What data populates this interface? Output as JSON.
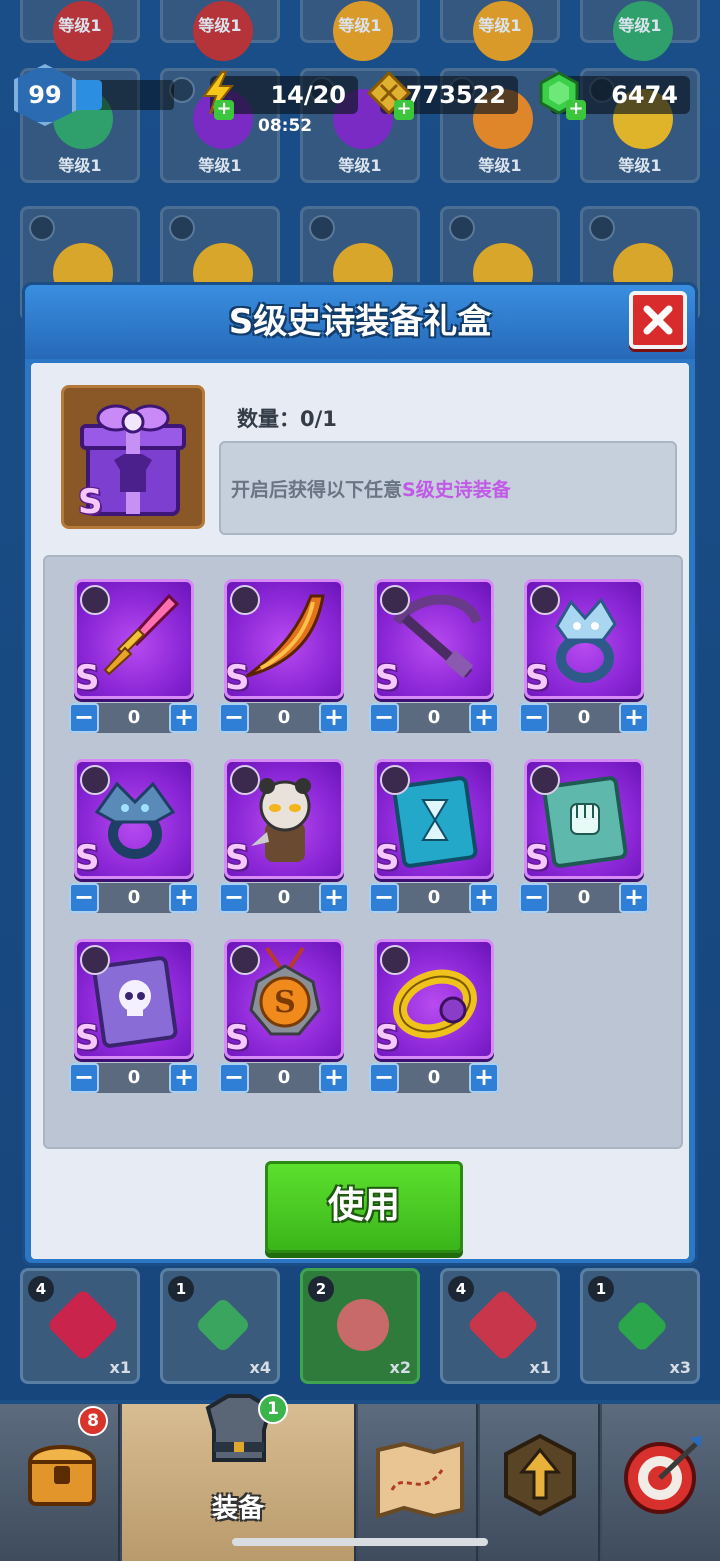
{
  "hud": {
    "level": "99",
    "energy": "14/20",
    "timer": "08:52",
    "gold": "773522",
    "gems": "6474"
  },
  "background": {
    "level_label": "等级1",
    "gem_counts": [
      "4",
      "1",
      "2",
      "4",
      "1"
    ],
    "gem_multipliers": [
      "x1",
      "x4",
      "x2",
      "x1",
      "x3"
    ]
  },
  "dialog": {
    "title": "S级史诗装备礼盒",
    "quantity_label": "数量：0/1",
    "description_prefix": "开启后获得以下任意",
    "description_highlight": "S级史诗装备",
    "box_grade": "S",
    "use_label": "使用",
    "items": [
      {
        "name": "sword",
        "type": "weapon",
        "grade": "S",
        "count": "0"
      },
      {
        "name": "curved-blade",
        "type": "weapon",
        "grade": "S",
        "count": "0"
      },
      {
        "name": "crossbow",
        "type": "weapon",
        "grade": "S",
        "count": "0"
      },
      {
        "name": "dragon-ring-ice",
        "type": "ring",
        "grade": "S",
        "count": "0"
      },
      {
        "name": "dragon-ring-dark",
        "type": "ring",
        "grade": "S",
        "count": "0"
      },
      {
        "name": "panda-pet",
        "type": "pet",
        "grade": "S",
        "count": "0"
      },
      {
        "name": "hourglass-book",
        "type": "book",
        "grade": "S",
        "count": "0"
      },
      {
        "name": "fist-book",
        "type": "book",
        "grade": "S",
        "count": "0"
      },
      {
        "name": "skull-book",
        "type": "book",
        "grade": "S",
        "count": "0"
      },
      {
        "name": "s-medallion",
        "type": "amulet",
        "grade": "S",
        "count": "0"
      },
      {
        "name": "gold-ring",
        "type": "bracelet",
        "grade": "S",
        "count": "0"
      }
    ]
  },
  "nav": {
    "chest_badge": "8",
    "equip_badge": "1",
    "equip_label": "装备"
  },
  "colors": {
    "epic_purple": "#8a26d6",
    "use_green": "#3bb51a",
    "close_red": "#d82c2c",
    "highlight_text": "#c15ae6"
  }
}
